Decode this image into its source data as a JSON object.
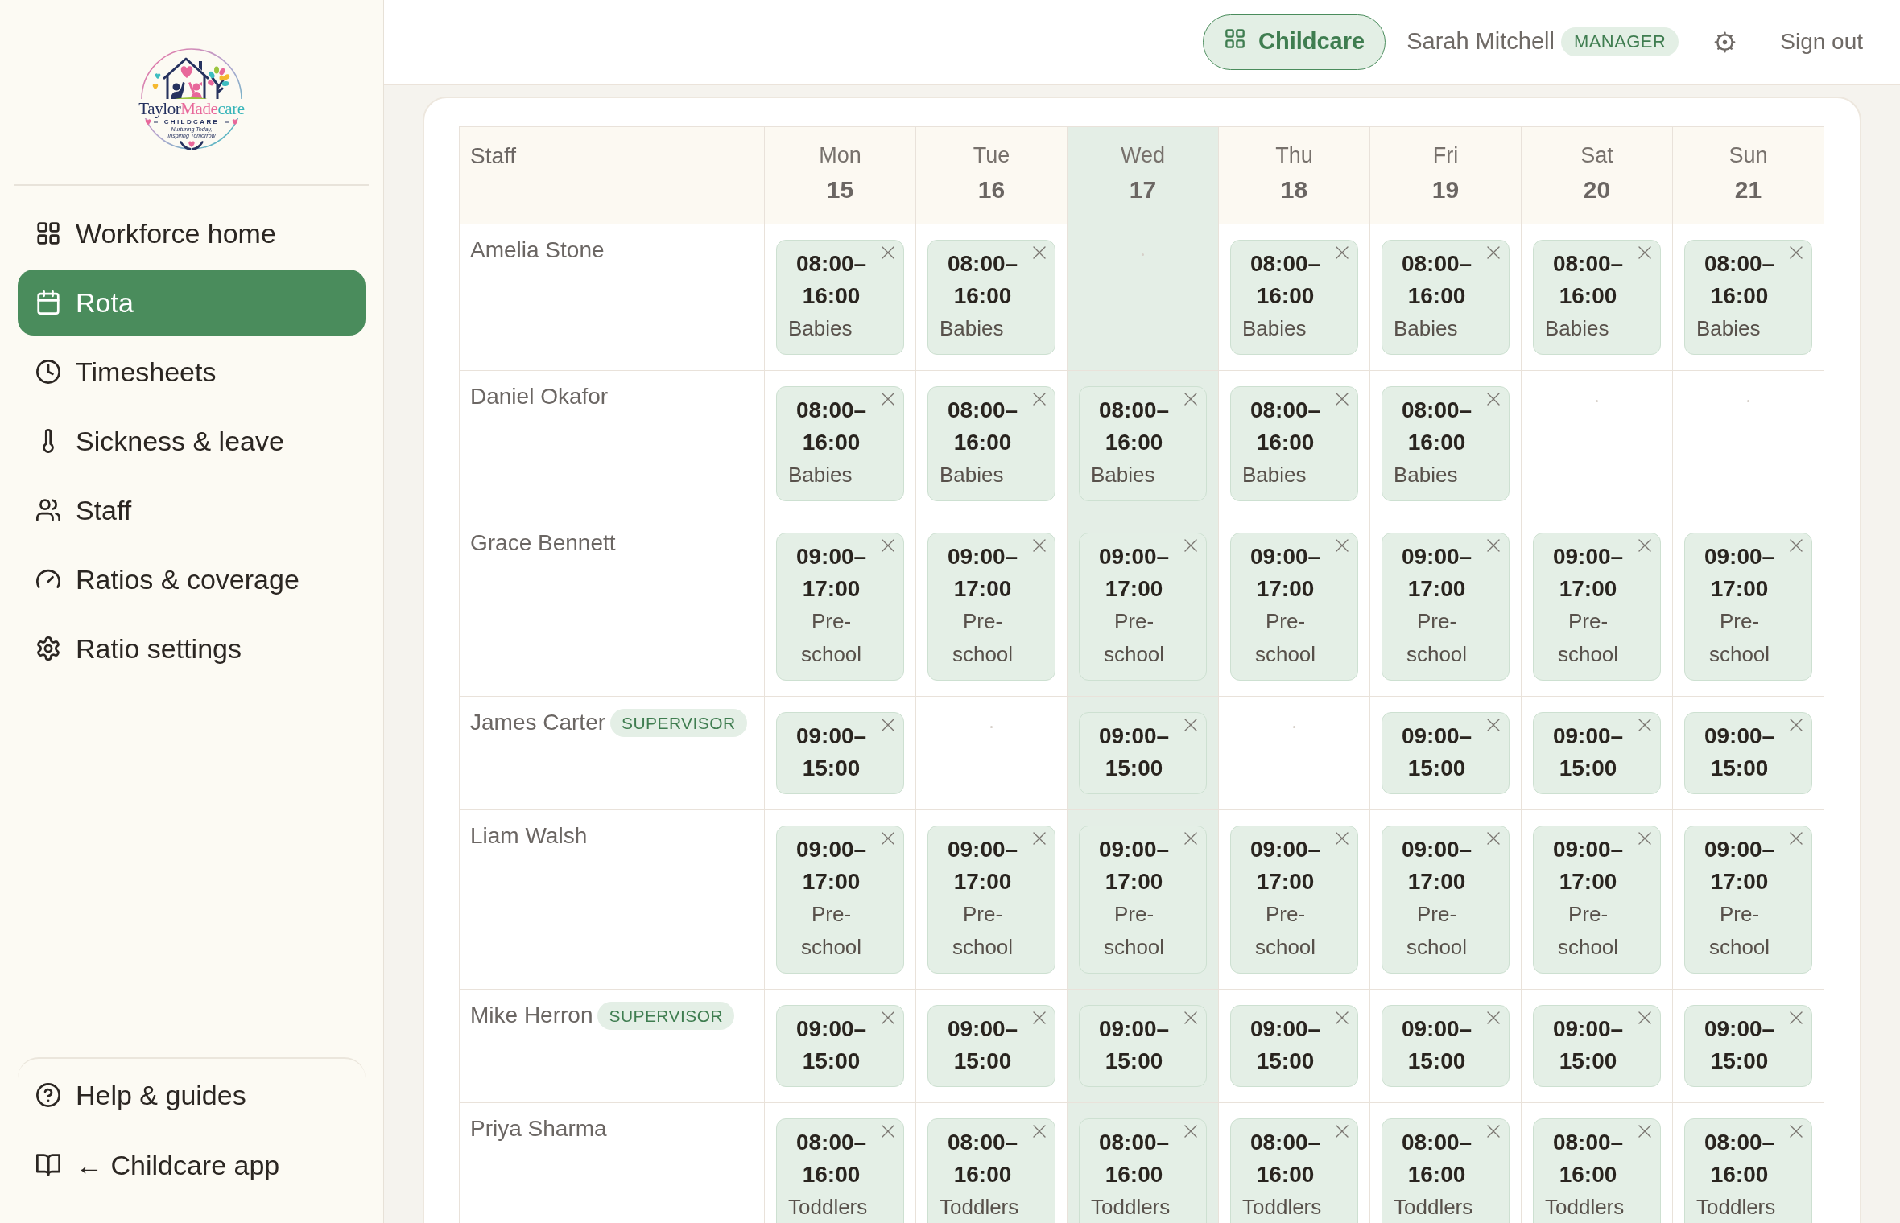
{
  "logo": {
    "wordmark": [
      {
        "text": "Taylor",
        "color": "#26325f"
      },
      {
        "text": "Made",
        "color": "#e8679a"
      },
      {
        "text": "care",
        "color": "#37b5b9"
      }
    ],
    "subtitle": "CHILDCARE",
    "tagline": "Nurturing Today, Inspiring Tomorrow"
  },
  "sidebar": {
    "items": [
      {
        "label": "Workforce home",
        "selected": false
      },
      {
        "label": "Rota",
        "selected": true
      },
      {
        "label": "Timesheets",
        "selected": false
      },
      {
        "label": "Sickness & leave",
        "selected": false
      },
      {
        "label": "Staff",
        "selected": false
      },
      {
        "label": "Ratios & coverage",
        "selected": false
      },
      {
        "label": "Ratio settings",
        "selected": false
      }
    ],
    "footer_items": [
      {
        "label": "Help & guides"
      },
      {
        "label": "← Childcare app"
      }
    ]
  },
  "header": {
    "app_switch": "Childcare",
    "user_name": "Sarah Mitchell",
    "user_role": "MANAGER",
    "sign_out": "Sign out"
  },
  "rota": {
    "staff_heading": "Staff",
    "days": [
      {
        "name": "Mon",
        "date": "15",
        "selected": false
      },
      {
        "name": "Tue",
        "date": "16",
        "selected": false
      },
      {
        "name": "Wed",
        "date": "17",
        "selected": true
      },
      {
        "name": "Thu",
        "date": "18",
        "selected": false
      },
      {
        "name": "Fri",
        "date": "19",
        "selected": false
      },
      {
        "name": "Sat",
        "date": "20",
        "selected": false
      },
      {
        "name": "Sun",
        "date": "21",
        "selected": false
      }
    ],
    "rows": [
      {
        "name": "Amelia Stone",
        "shifts": [
          {
            "kind": "shift",
            "time": "08:00–16:00",
            "room": "Babies"
          },
          {
            "kind": "shift",
            "time": "08:00–16:00",
            "room": "Babies"
          },
          {
            "kind": "empty"
          },
          {
            "kind": "shift",
            "time": "08:00–16:00",
            "room": "Babies"
          },
          {
            "kind": "shift",
            "time": "08:00–16:00",
            "room": "Babies"
          },
          {
            "kind": "shift",
            "time": "08:00–16:00",
            "room": "Babies"
          },
          {
            "kind": "shift",
            "time": "08:00–16:00",
            "room": "Babies"
          }
        ]
      },
      {
        "name": "Daniel Okafor",
        "shifts": [
          {
            "kind": "shift",
            "time": "08:00–16:00",
            "room": "Babies"
          },
          {
            "kind": "shift",
            "time": "08:00–16:00",
            "room": "Babies"
          },
          {
            "kind": "shift",
            "time": "08:00–16:00",
            "room": "Babies"
          },
          {
            "kind": "shift",
            "time": "08:00–16:00",
            "room": "Babies"
          },
          {
            "kind": "shift",
            "time": "08:00–16:00",
            "room": "Babies"
          },
          {
            "kind": "empty"
          },
          {
            "kind": "empty"
          }
        ]
      },
      {
        "name": "Grace Bennett",
        "shifts": [
          {
            "kind": "shift",
            "time": "09:00–17:00",
            "room": "Pre-school"
          },
          {
            "kind": "shift",
            "time": "09:00–17:00",
            "room": "Pre-school"
          },
          {
            "kind": "shift",
            "time": "09:00–17:00",
            "room": "Pre-school"
          },
          {
            "kind": "shift",
            "time": "09:00–17:00",
            "room": "Pre-school"
          },
          {
            "kind": "shift",
            "time": "09:00–17:00",
            "room": "Pre-school"
          },
          {
            "kind": "shift",
            "time": "09:00–17:00",
            "room": "Pre-school"
          },
          {
            "kind": "shift",
            "time": "09:00–17:00",
            "room": "Pre-school"
          }
        ]
      },
      {
        "name": "James Carter",
        "badge": "SUPERVISOR",
        "shifts": [
          {
            "kind": "shift",
            "time": "09:00–15:00"
          },
          {
            "kind": "empty"
          },
          {
            "kind": "shift",
            "time": "09:00–15:00"
          },
          {
            "kind": "empty"
          },
          {
            "kind": "shift",
            "time": "09:00–15:00"
          },
          {
            "kind": "shift",
            "time": "09:00–15:00"
          },
          {
            "kind": "shift",
            "time": "09:00–15:00"
          }
        ]
      },
      {
        "name": "Liam Walsh",
        "shifts": [
          {
            "kind": "shift",
            "time": "09:00–17:00",
            "room": "Pre-school"
          },
          {
            "kind": "shift",
            "time": "09:00–17:00",
            "room": "Pre-school"
          },
          {
            "kind": "shift",
            "time": "09:00–17:00",
            "room": "Pre-school"
          },
          {
            "kind": "shift",
            "time": "09:00–17:00",
            "room": "Pre-school"
          },
          {
            "kind": "shift",
            "time": "09:00–17:00",
            "room": "Pre-school"
          },
          {
            "kind": "shift",
            "time": "09:00–17:00",
            "room": "Pre-school"
          },
          {
            "kind": "shift",
            "time": "09:00–17:00",
            "room": "Pre-school"
          }
        ]
      },
      {
        "name": "Mike Herron",
        "badge": "SUPERVISOR",
        "shifts": [
          {
            "kind": "shift",
            "time": "09:00–15:00"
          },
          {
            "kind": "shift",
            "time": "09:00–15:00"
          },
          {
            "kind": "shift",
            "time": "09:00–15:00"
          },
          {
            "kind": "shift",
            "time": "09:00–15:00"
          },
          {
            "kind": "shift",
            "time": "09:00–15:00"
          },
          {
            "kind": "shift",
            "time": "09:00–15:00"
          },
          {
            "kind": "shift",
            "time": "09:00–15:00"
          }
        ]
      },
      {
        "name": "Priya Sharma",
        "shifts": [
          {
            "kind": "shift",
            "time": "08:00–16:00",
            "room": "Toddlers"
          },
          {
            "kind": "shift",
            "time": "08:00–16:00",
            "room": "Toddlers"
          },
          {
            "kind": "shift",
            "time": "08:00–16:00",
            "room": "Toddlers"
          },
          {
            "kind": "shift",
            "time": "08:00–16:00",
            "room": "Toddlers"
          },
          {
            "kind": "shift",
            "time": "08:00–16:00",
            "room": "Toddlers"
          },
          {
            "kind": "shift",
            "time": "08:00–16:00",
            "room": "Toddlers"
          },
          {
            "kind": "shift",
            "time": "08:00–16:00",
            "room": "Toddlers"
          }
        ]
      }
    ]
  }
}
